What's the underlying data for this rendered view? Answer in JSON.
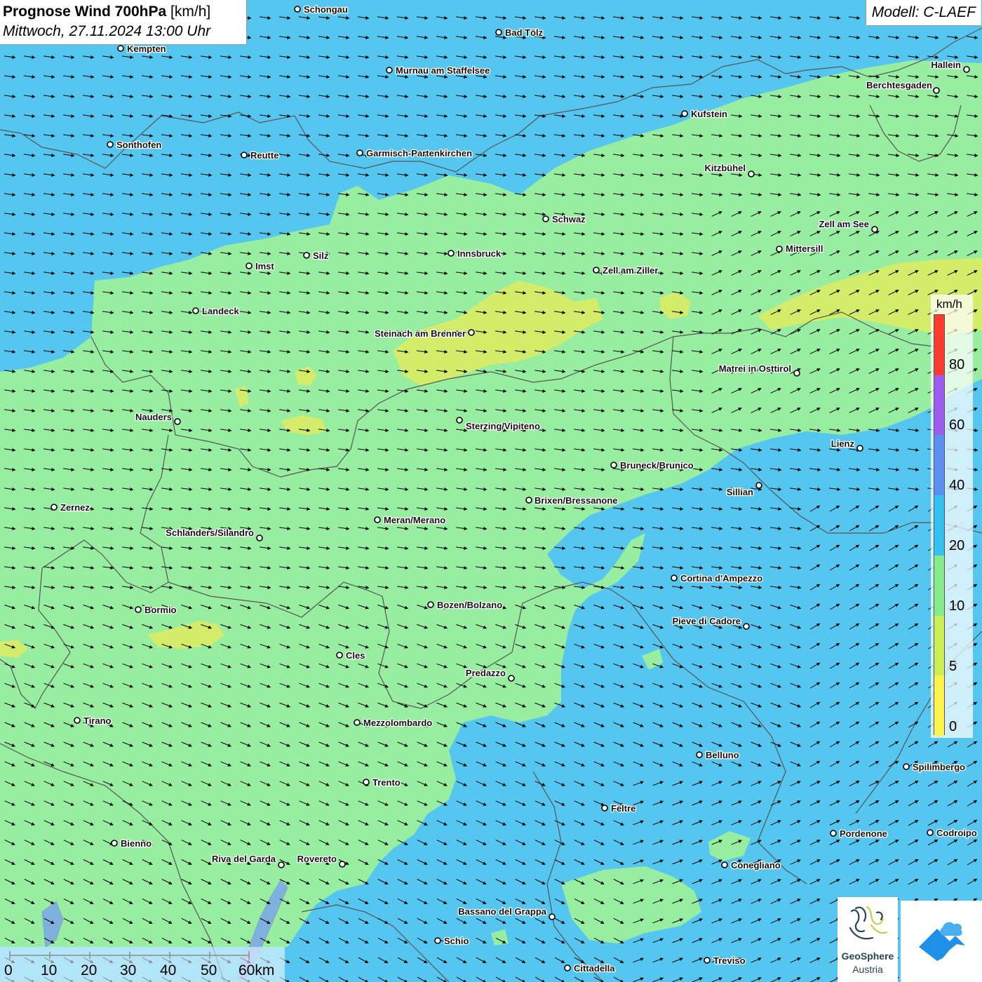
{
  "title": {
    "bold": "Prognose Wind 700hPa",
    "unit": "[km/h]",
    "datetime": "Mittwoch, 27.11.2024 13:00 Uhr"
  },
  "model": "Modell: C-LAEF",
  "legend": {
    "unit": "km/h",
    "ticks": [
      "80",
      "60",
      "40",
      "20",
      "10",
      "5",
      "0"
    ],
    "colors": [
      "#ff3b30",
      "#9e5bef",
      "#5b8ff0",
      "#35c0f0",
      "#86ec8b",
      "#cbee55",
      "#fff24a"
    ]
  },
  "scale_bar": {
    "labels": [
      "0",
      "10",
      "20",
      "30",
      "40",
      "50",
      "60km"
    ]
  },
  "logos": {
    "geosphere_name": "GeoSphere",
    "geosphere_sub": "Austria"
  },
  "colors": {
    "band_20_40": "#55c6ef",
    "band_10_20": "#98eea0",
    "band_5_10": "#d4ec6a",
    "border": "#555555",
    "arrow": "#000000"
  },
  "wind_direction": "west to east (roughly westerly, veering north-westerly in the south-east)",
  "cities": [
    {
      "name": "Schongau"
    },
    {
      "name": "Bad Tölz"
    },
    {
      "name": "Kempten"
    },
    {
      "name": "Murnau am Staffelsee"
    },
    {
      "name": "Hallein"
    },
    {
      "name": "Berchtesgaden"
    },
    {
      "name": "Kufstein"
    },
    {
      "name": "Sonthofen"
    },
    {
      "name": "Reutte"
    },
    {
      "name": "Garmisch-Partenkirchen"
    },
    {
      "name": "Kitzbühel"
    },
    {
      "name": "Schwaz"
    },
    {
      "name": "Zell am See"
    },
    {
      "name": "Mittersill"
    },
    {
      "name": "Innsbruck"
    },
    {
      "name": "Silz"
    },
    {
      "name": "Imst"
    },
    {
      "name": "Zell am Ziller"
    },
    {
      "name": "Landeck"
    },
    {
      "name": "Steinach am Brenner"
    },
    {
      "name": "Matrei in Osttirol"
    },
    {
      "name": "Nauders"
    },
    {
      "name": "Sterzing/Vipiteno"
    },
    {
      "name": "Lienz"
    },
    {
      "name": "Bruneck/Brunico"
    },
    {
      "name": "Sillian"
    },
    {
      "name": "Brixen/Bressanone"
    },
    {
      "name": "Zernez"
    },
    {
      "name": "Meran/Merano"
    },
    {
      "name": "Schlanders/Silandro"
    },
    {
      "name": "Cortina d'Ampezzo"
    },
    {
      "name": "Bozen/Bolzano"
    },
    {
      "name": "Bormio"
    },
    {
      "name": "Pieve di Cadore"
    },
    {
      "name": "Cles"
    },
    {
      "name": "Predazzo"
    },
    {
      "name": "Tirano"
    },
    {
      "name": "Mezzolombardo"
    },
    {
      "name": "Belluno"
    },
    {
      "name": "Spilimbergo"
    },
    {
      "name": "Trento"
    },
    {
      "name": "Feltre"
    },
    {
      "name": "Bienno"
    },
    {
      "name": "Pordenone"
    },
    {
      "name": "Codroipo"
    },
    {
      "name": "Riva del Garda"
    },
    {
      "name": "Rovereto"
    },
    {
      "name": "Conegliano"
    },
    {
      "name": "Bassano del Grappa"
    },
    {
      "name": "Schio"
    },
    {
      "name": "Treviso"
    },
    {
      "name": "Cittadella"
    }
  ]
}
